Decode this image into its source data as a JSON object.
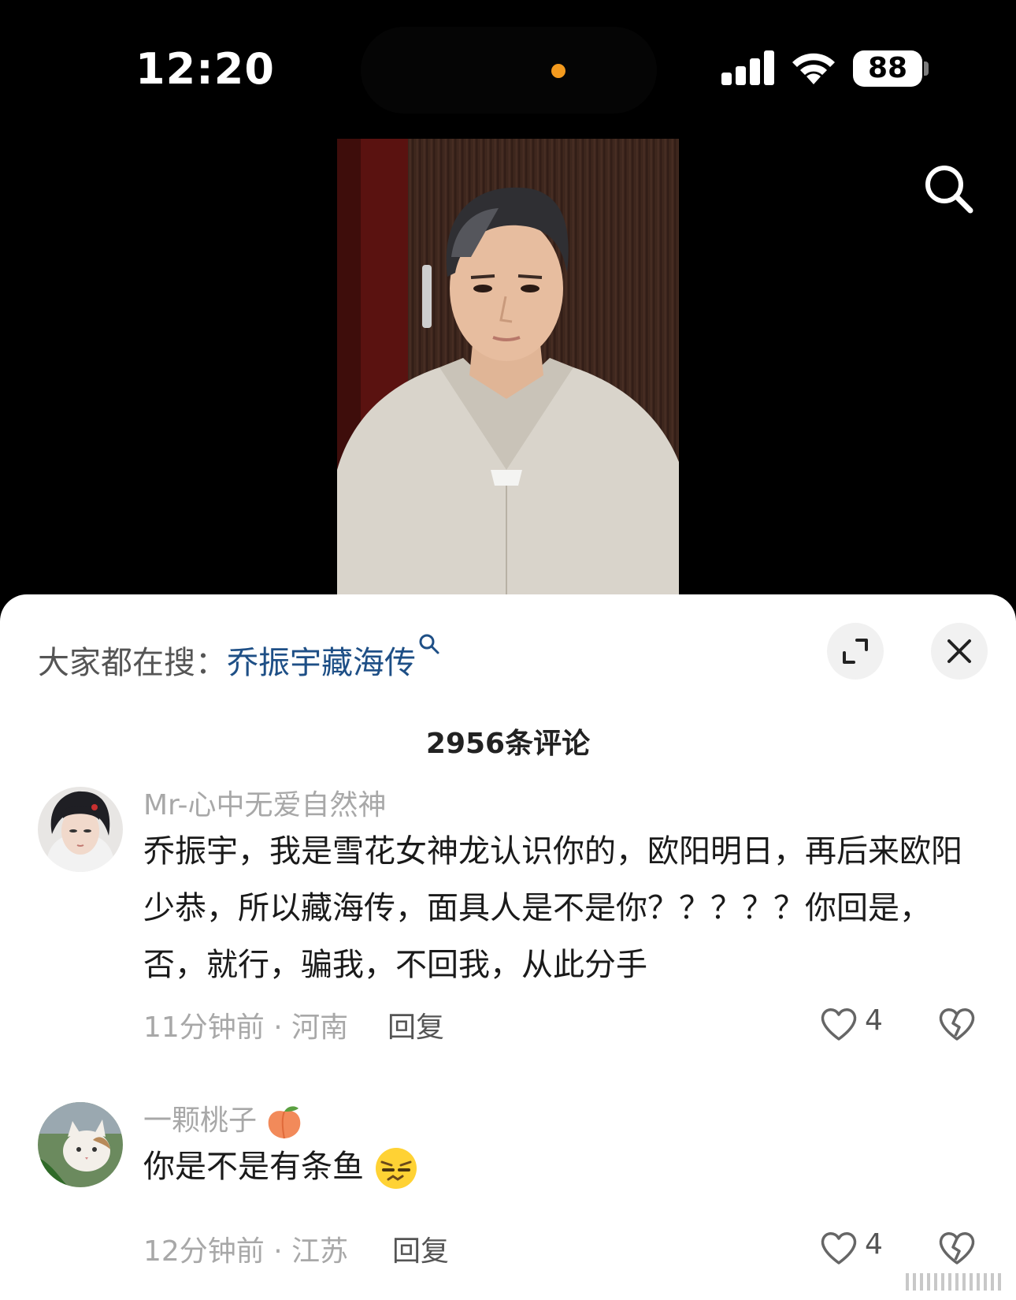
{
  "status_bar": {
    "time": "12:20",
    "battery": "88",
    "icons": [
      "signal-icon",
      "wifi-icon",
      "battery-icon"
    ]
  },
  "video": {
    "search_icon": "search-icon"
  },
  "sheet": {
    "hot_search_prefix": "大家都在搜：",
    "hot_search_term": "乔振宇藏海传",
    "comment_count": "2956条评论",
    "expand_icon": "expand-icon",
    "close_icon": "close-icon"
  },
  "comments": [
    {
      "username": "Mr-心中无爱自然神",
      "text": "乔振宇，我是雪花女神龙认识你的，欧阳明日，再后来欧阳少恭，所以藏海传，面具人是不是你？？？？？你回是，否，就行，骗我，不回我，从此分手",
      "time_location": "11分钟前 · 河南",
      "reply_label": "回复",
      "likes": "4"
    },
    {
      "username": "一颗桃子",
      "text": "你是不是有条鱼",
      "time_location": "12分钟前 · 江苏",
      "reply_label": "回复",
      "likes": "4"
    }
  ],
  "colors": {
    "background": "#000000",
    "sheet": "#ffffff",
    "link": "#1e4f86",
    "muted": "#a8a8a8",
    "dynamic_island_dot": "#f39a1e"
  }
}
